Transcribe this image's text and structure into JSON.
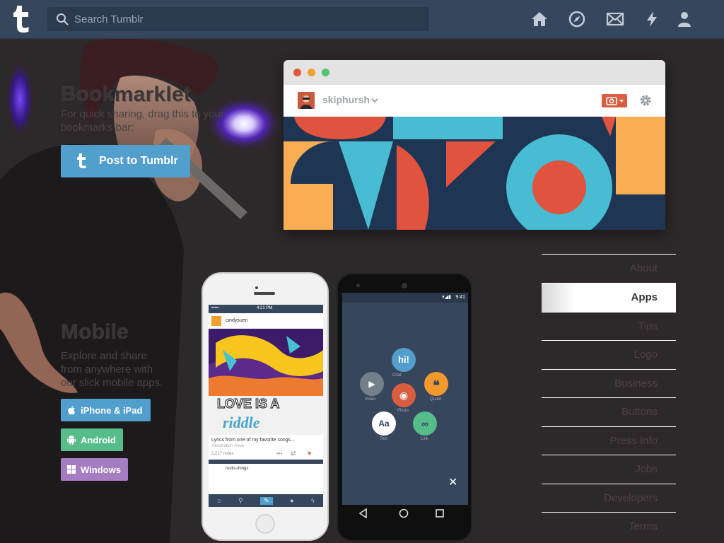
{
  "header": {
    "search_placeholder": "Search Tumblr",
    "icons": [
      "home-icon",
      "explore-icon",
      "inbox-icon",
      "activity-icon",
      "account-icon"
    ]
  },
  "bookmarklet": {
    "title": "Bookmarklet",
    "description": "For quick sharing, drag this to your bookmarks bar:",
    "button_label": "Post to Tumblr"
  },
  "browser": {
    "blog_name": "skiphursh"
  },
  "mobile": {
    "title": "Mobile",
    "description": "Explore and share from anywhere with our slick mobile apps.",
    "buttons": [
      {
        "label": "iPhone & iPad",
        "color": "#529ecc"
      },
      {
        "label": "Android",
        "color": "#56bc8a"
      },
      {
        "label": "Windows",
        "color": "#a77dc2"
      }
    ]
  },
  "iphone": {
    "status_carrier": "•••••",
    "status_time": "4:21 PM",
    "post_author": "cindysuen",
    "post_caption": "Lyrics from one of my favorite songs...",
    "post_tags": "#illustration  #love",
    "post_notes": "3,217 notes",
    "next_author": "rustic-things",
    "art_text_1": "LOVE IS A",
    "art_text_2": "riddle"
  },
  "android": {
    "status_time": "9:41",
    "menu": [
      {
        "label": "Chat",
        "glyph": "hi!",
        "color": "#529ecc"
      },
      {
        "label": "Video",
        "glyph": "▶",
        "color": "#748089"
      },
      {
        "label": "Quote",
        "glyph": "❝",
        "color": "#f2992e"
      },
      {
        "label": "Photo",
        "glyph": "◉",
        "color": "#d95e40"
      },
      {
        "label": "Text",
        "glyph": "Aa",
        "color": "#ffffff"
      },
      {
        "label": "Link",
        "glyph": "∞",
        "color": "#56bc8a"
      }
    ]
  },
  "sidebar": {
    "items": [
      {
        "label": "About"
      },
      {
        "label": "Apps"
      },
      {
        "label": "Tips"
      },
      {
        "label": "Logo"
      },
      {
        "label": "Business"
      },
      {
        "label": "Buttons"
      },
      {
        "label": "Press Info"
      },
      {
        "label": "Jobs"
      },
      {
        "label": "Developers"
      },
      {
        "label": "Terms"
      }
    ],
    "active": "Apps"
  },
  "colors": {
    "header_bg": "#36465d",
    "page_bg": "#2d2829",
    "accent_blue": "#529ecc"
  }
}
